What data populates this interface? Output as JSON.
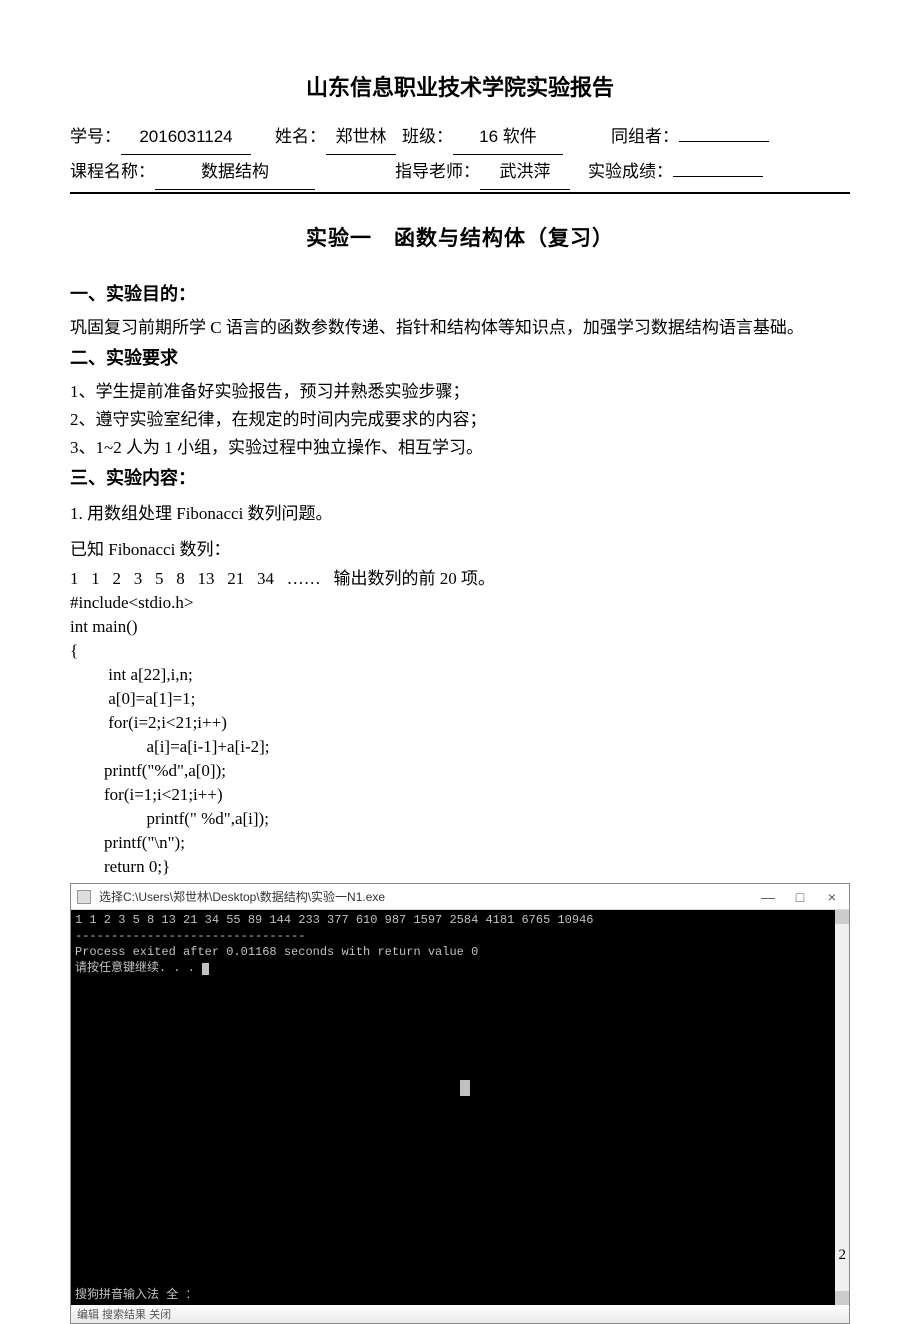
{
  "report_title": "山东信息职业技术学院实验报告",
  "header": {
    "student_id_label": "学号：",
    "student_id": "2016031124",
    "name_label": "姓名：",
    "name": "郑世林",
    "class_label": "班级：",
    "class": "16 软件",
    "partner_label": "同组者：",
    "partner": "",
    "course_label": "课程名称：",
    "course": "数据结构",
    "teacher_label": "指导老师：",
    "teacher": "武洪萍",
    "score_label": "实验成绩：",
    "score": ""
  },
  "experiment_title": "实验一　函数与结构体（复习）",
  "sec1": {
    "heading": "一、实验目的：",
    "p1": "巩固复习前期所学 C 语言的函数参数传递、指针和结构体等知识点，加强学习数据结构语言基础。"
  },
  "sec2": {
    "heading": "二、实验要求",
    "l1": "1、学生提前准备好实验报告，预习并熟悉实验步骤；",
    "l2": "2、遵守实验室纪律，在规定的时间内完成要求的内容；",
    "l3": "3、1~2 人为 1 小组，实验过程中独立操作、相互学习。"
  },
  "sec3": {
    "heading": "三、实验内容：",
    "q1": "1. 用数组处理 Fibonacci 数列问题。",
    "q2": "已知 Fibonacci 数列：",
    "fib_line": "1   1   2   3   5   8   13   21   34   ……   输出数列的前 20 项。"
  },
  "code": "#include<stdio.h>\nint main()\n{\n         int a[22],i,n;\n         a[0]=a[1]=1;\n         for(i=2;i<21;i++)\n                  a[i]=a[i-1]+a[i-2];\n        printf(\"%d\",a[0]);\n        for(i=1;i<21;i++)\n                  printf(\" %d\",a[i]);\n        printf(\"\\n\");\n        return 0;}",
  "console": {
    "title": "选择C:\\Users\\郑世林\\Desktop\\数据结构\\实验一N1.exe",
    "line1": "1 1 2 3 5 8 13 21 34 55 89 144 233 377 610 987 1597 2584 4181 6765 10946",
    "line2": "--------------------------------",
    "line3": "Process exited after 0.01168 seconds with return value 0",
    "line4": "请按任意键继续. . . ",
    "ime": "搜狗拼音输入法 全 ：",
    "min_label": "—",
    "max_label": "□",
    "close_label": "×"
  },
  "toolbar_fragment": "编辑  搜索结果  关闭",
  "page_number": "2"
}
